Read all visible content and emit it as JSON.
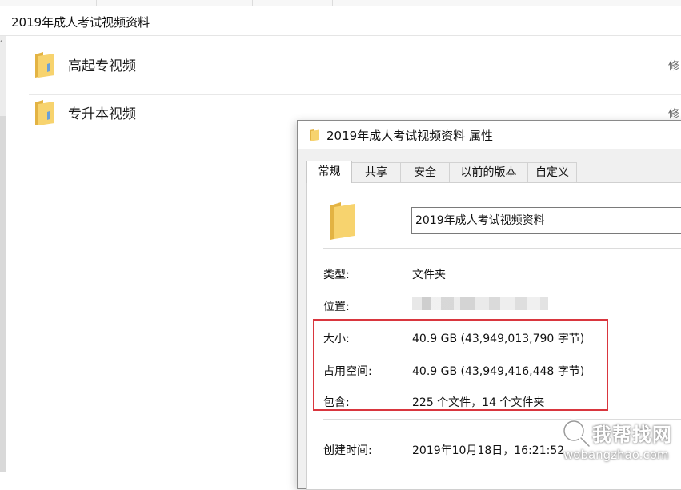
{
  "explorer": {
    "address_path": "2019年成人考试视频资料",
    "items": [
      {
        "name": "高起专视频",
        "meta": "修"
      },
      {
        "name": "专升本视频",
        "meta": "修"
      }
    ]
  },
  "dialog": {
    "title": "2019年成人考试视频资料 属性",
    "tabs": [
      {
        "label": "常规",
        "active": true
      },
      {
        "label": "共享"
      },
      {
        "label": "安全"
      },
      {
        "label": "以前的版本"
      },
      {
        "label": "自定义"
      }
    ],
    "folder_name": "2019年成人考试视频资料",
    "properties": {
      "type": {
        "label": "类型:",
        "value": "文件夹"
      },
      "location": {
        "label": "位置:"
      },
      "size": {
        "label": "大小:",
        "value": "40.9 GB (43,949,013,790 字节)"
      },
      "disk": {
        "label": "占用空间:",
        "value": "40.9 GB (43,949,416,448 字节)"
      },
      "contains": {
        "label": "包含:",
        "value": "225 个文件，14 个文件夹"
      },
      "created": {
        "label": "创建时间:",
        "value": "2019年10月18日，16:21:52"
      }
    }
  },
  "watermark": {
    "cn": "我帮找网",
    "en": "wobangzhao.com"
  },
  "colors": {
    "highlight": "#d9363e",
    "folder": "#f4c75a"
  }
}
